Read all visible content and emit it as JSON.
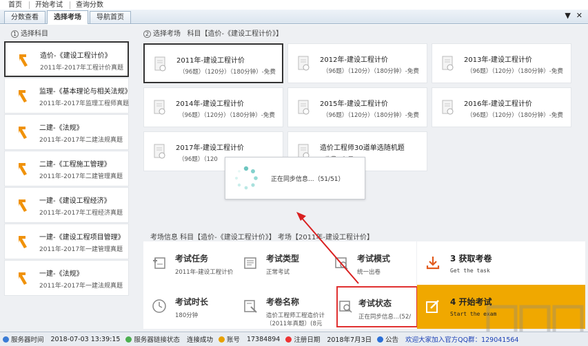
{
  "menu": [
    "首页",
    "开始考试",
    "查询分数"
  ],
  "tabs": [
    "分数查看",
    "选择考场",
    "导航首页"
  ],
  "tab_controls": [
    "▼",
    "✕"
  ],
  "left": {
    "title_num": "1",
    "title": "选择科目",
    "subjects": [
      {
        "name": "造价-《建设工程计价》",
        "desc": "2011年-2017年工程计价真题",
        "selected": true
      },
      {
        "name": "监理-《基本理论与相关法规》",
        "desc": "2011年-2017年监理工程师真题",
        "selected": false
      },
      {
        "name": "二建-《法规》",
        "desc": "2011年-2017年二建法规真题",
        "selected": false
      },
      {
        "name": "二建-《工程施工管理》",
        "desc": "2011年-2017年二建管理真题",
        "selected": false
      },
      {
        "name": "一建-《建设工程经济》",
        "desc": "2011年-2017年工程经济真题",
        "selected": false
      },
      {
        "name": "一建-《建设工程项目管理》",
        "desc": "2011年-2017年一建管理真题",
        "selected": false
      },
      {
        "name": "一建-《法规》",
        "desc": "2011年-2017年一建法规真题",
        "selected": false
      }
    ]
  },
  "right": {
    "title_num": "2",
    "title": "选择考场",
    "subject_label": "科目【造价-《建设工程计价》】",
    "exams": [
      {
        "name": "2011年-建设工程计价",
        "desc": "（96题）（120分）（180分钟）-免费",
        "selected": true
      },
      {
        "name": "2012年-建设工程计价",
        "desc": "（96题）（120分）（180分钟）-免费",
        "selected": false
      },
      {
        "name": "2013年-建设工程计价",
        "desc": "（96题）（120分）（180分钟）-免费",
        "selected": false
      },
      {
        "name": "2014年-建设工程计价",
        "desc": "（96题）（120分）（180分钟）-免费",
        "selected": false
      },
      {
        "name": "2015年-建设工程计价",
        "desc": "（96题）（120分）（180分钟）-免费",
        "selected": false
      },
      {
        "name": "2016年-建设工程计价",
        "desc": "（96题）（120分）（180分钟）-免费",
        "selected": false
      },
      {
        "name": "2017年-建设工程计价",
        "desc": "（96题）（120",
        "selected": false
      },
      {
        "name": "造价工程师30道单选随机题",
        "desc": "-收费：1 元",
        "selected": false
      }
    ]
  },
  "loading": {
    "text": "正在同步信息...（51/51）"
  },
  "info": {
    "header": "考场信息   科目【造价-《建设工程计价》】 考场【2011年-建设工程计价】",
    "cells": [
      {
        "label": "考试任务",
        "value": "2011年-建设工程计价",
        "value2": ""
      },
      {
        "label": "考试类型",
        "value": "正常考试",
        "value2": ""
      },
      {
        "label": "考试模式",
        "value": "统一出卷",
        "value2": ""
      },
      {
        "label": "考试时长",
        "value": "180分钟",
        "value2": ""
      },
      {
        "label": "考卷名称",
        "value": "造价工程师工程造价计",
        "value2": "（2011年真题）(8元"
      },
      {
        "label": "考试状态",
        "value": "正在同步信息...(52/",
        "value2": ""
      }
    ]
  },
  "actions": {
    "get": {
      "num": "3",
      "label": "获取考卷",
      "sub": "Get the task"
    },
    "start": {
      "num": "4",
      "label": "开始考试",
      "sub": "Start the exam"
    }
  },
  "status": {
    "server_time_label": "服务器时间",
    "server_time": "2018-07-03 13:39:15",
    "conn_label": "服务器链接状态",
    "conn_value": "连接成功",
    "account_label": "账号",
    "account": "17384894",
    "reg_label": "注册日期",
    "reg_date": "2018年7月3日",
    "notice_label": "公告",
    "notice": "欢迎大家加入官方QQ群：129041564"
  },
  "colors": {
    "accent": "#f0a800",
    "highlight": "#e03030",
    "arrow": "#f07a10"
  }
}
